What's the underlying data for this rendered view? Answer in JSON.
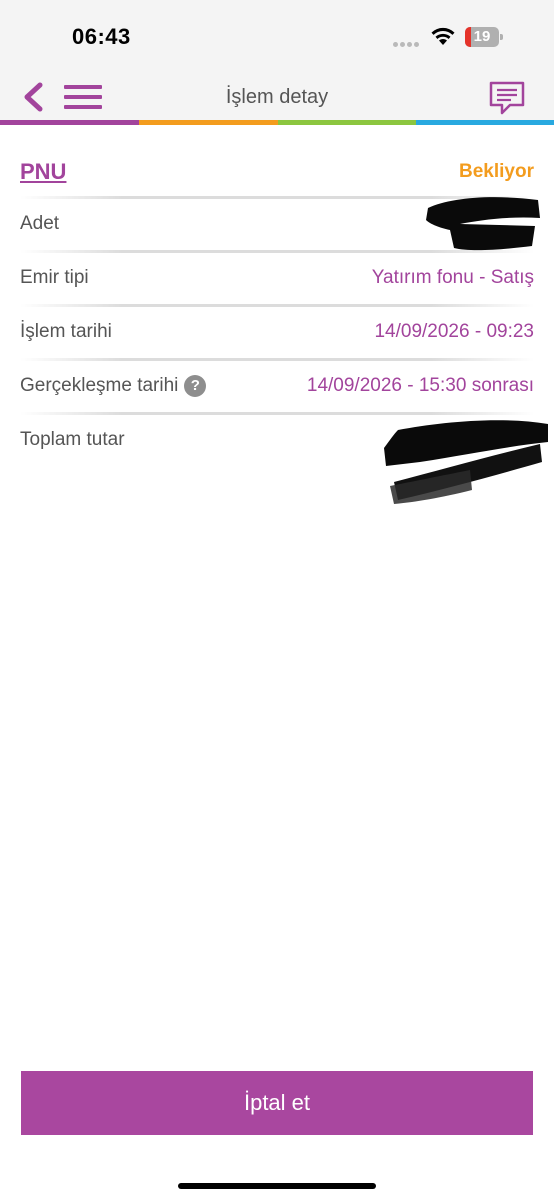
{
  "status_bar": {
    "time": "06:43",
    "battery_level": "19",
    "battery_fraction": 0.19
  },
  "header": {
    "title": "İşlem detay",
    "back_icon": "chevron-left-icon",
    "menu_icon": "hamburger-menu-icon",
    "chat_icon": "chat-bubble-icon"
  },
  "colors": {
    "brand_purple": "#a2449c",
    "button_purple": "#a9479f",
    "pending_orange": "#f39c1e",
    "rainbow": [
      "#a2449c",
      "#f39c1e",
      "#8cc63f",
      "#29a9e0"
    ]
  },
  "order": {
    "fund_code": "PNU",
    "status": "Bekliyor",
    "rows": [
      {
        "label": "Adet",
        "value": ""
      },
      {
        "label": "Emir tipi",
        "value": "Yatırım fonu - Satış"
      },
      {
        "label": "İşlem tarihi",
        "value": "14/09/2026 - 09:23"
      },
      {
        "label": "Gerçekleşme tarihi",
        "value": "14/09/2026 - 15:30 sonrası"
      },
      {
        "label": "Toplam tutar",
        "value": ""
      }
    ],
    "help_glyph": "?"
  },
  "actions": {
    "cancel_label": "İptal et"
  }
}
